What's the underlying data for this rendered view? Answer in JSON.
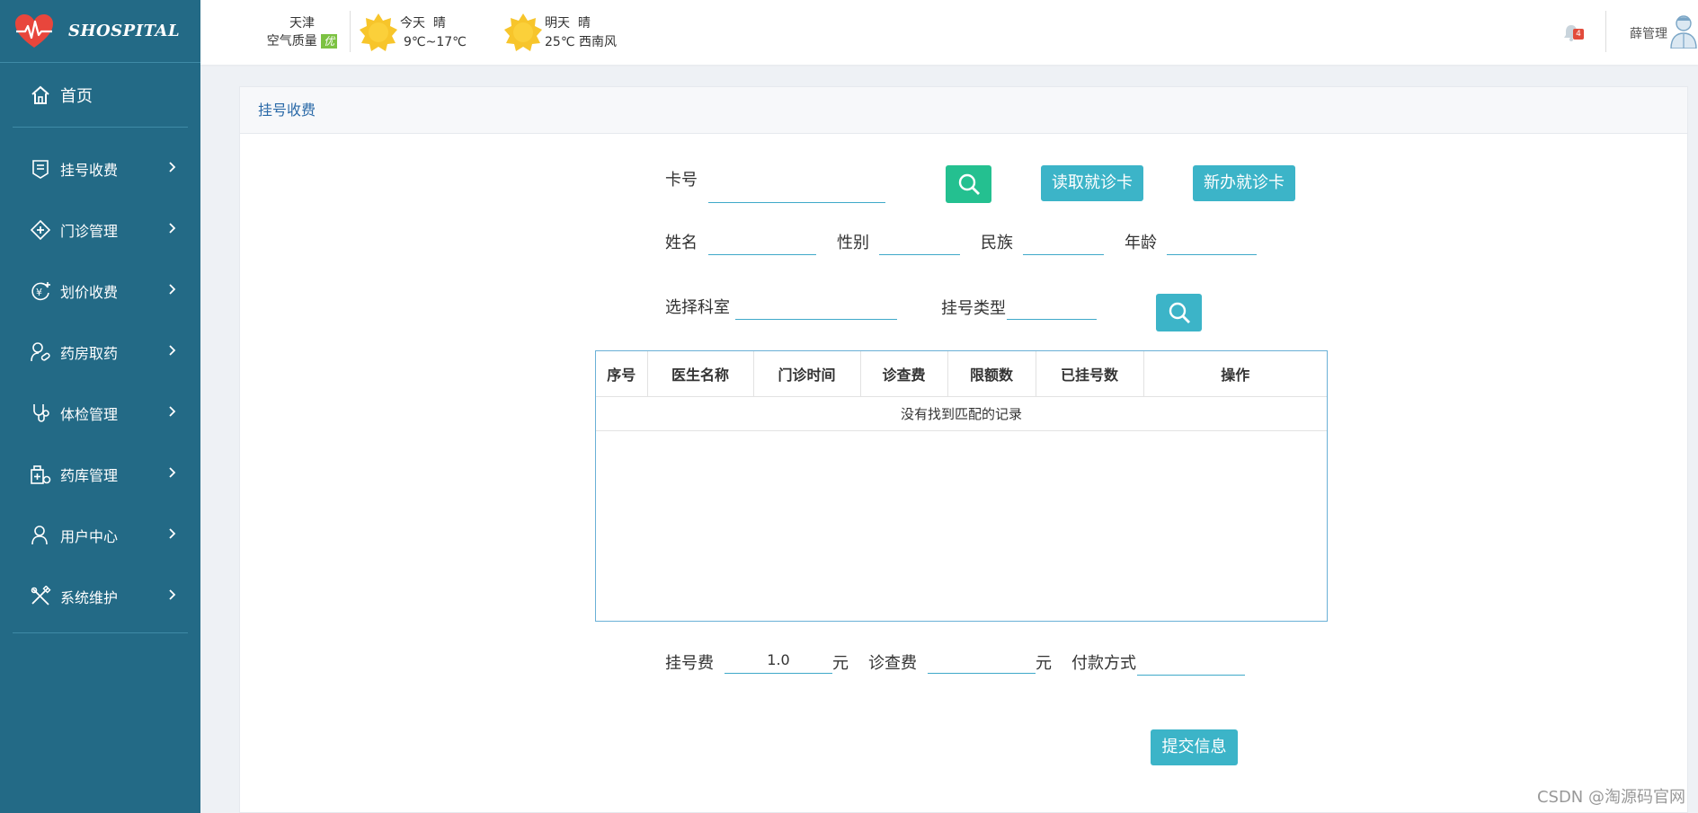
{
  "brand": {
    "name": "SHOSPITAL"
  },
  "sidebar": {
    "home": {
      "label": "首页",
      "icon": "home-icon"
    },
    "items": [
      {
        "label": "挂号收费",
        "icon": "register-icon"
      },
      {
        "label": "门诊管理",
        "icon": "clinic-icon"
      },
      {
        "label": "划价收费",
        "icon": "pricing-icon"
      },
      {
        "label": "药房取药",
        "icon": "pharmacy-icon"
      },
      {
        "label": "体检管理",
        "icon": "stethoscope-icon"
      },
      {
        "label": "药库管理",
        "icon": "drug-storage-icon"
      },
      {
        "label": "用户中心",
        "icon": "user-icon"
      },
      {
        "label": "系统维护",
        "icon": "tools-icon"
      }
    ]
  },
  "header": {
    "city": "天津",
    "air_quality_label": "空气质量",
    "air_quality_value": "优",
    "today": {
      "label": "今天",
      "condition": "晴",
      "temp": "9℃~17℃"
    },
    "tomorrow": {
      "label": "明天",
      "condition": "晴",
      "detail": "25℃ 西南风"
    },
    "notification_count": "4",
    "user_name": "薛管理"
  },
  "panel": {
    "title": "挂号收费",
    "card_label": "卡号",
    "card_value": "",
    "read_card_button": "读取就诊卡",
    "new_card_button": "新办就诊卡",
    "name_label": "姓名",
    "gender_label": "性别",
    "ethnicity_label": "民族",
    "age_label": "年龄",
    "department_label": "选择科室",
    "reg_type_label": "挂号类型",
    "table": {
      "headers": [
        "序号",
        "医生名称",
        "门诊时间",
        "诊查费",
        "限额数",
        "已挂号数",
        "操作"
      ],
      "empty_text": "没有找到匹配的记录"
    },
    "reg_fee_label": "挂号费",
    "reg_fee_value": "1.0",
    "unit": "元",
    "exam_fee_label": "诊查费",
    "exam_fee_value": "",
    "payment_label": "付款方式",
    "payment_value": "",
    "submit_button": "提交信息"
  },
  "watermark": "CSDN @淘源码官网",
  "colors": {
    "sidebar_bg": "#236a86",
    "accent": "#3cb4c8",
    "search_green": "#24c090",
    "panel_title": "#2b6aa8"
  }
}
